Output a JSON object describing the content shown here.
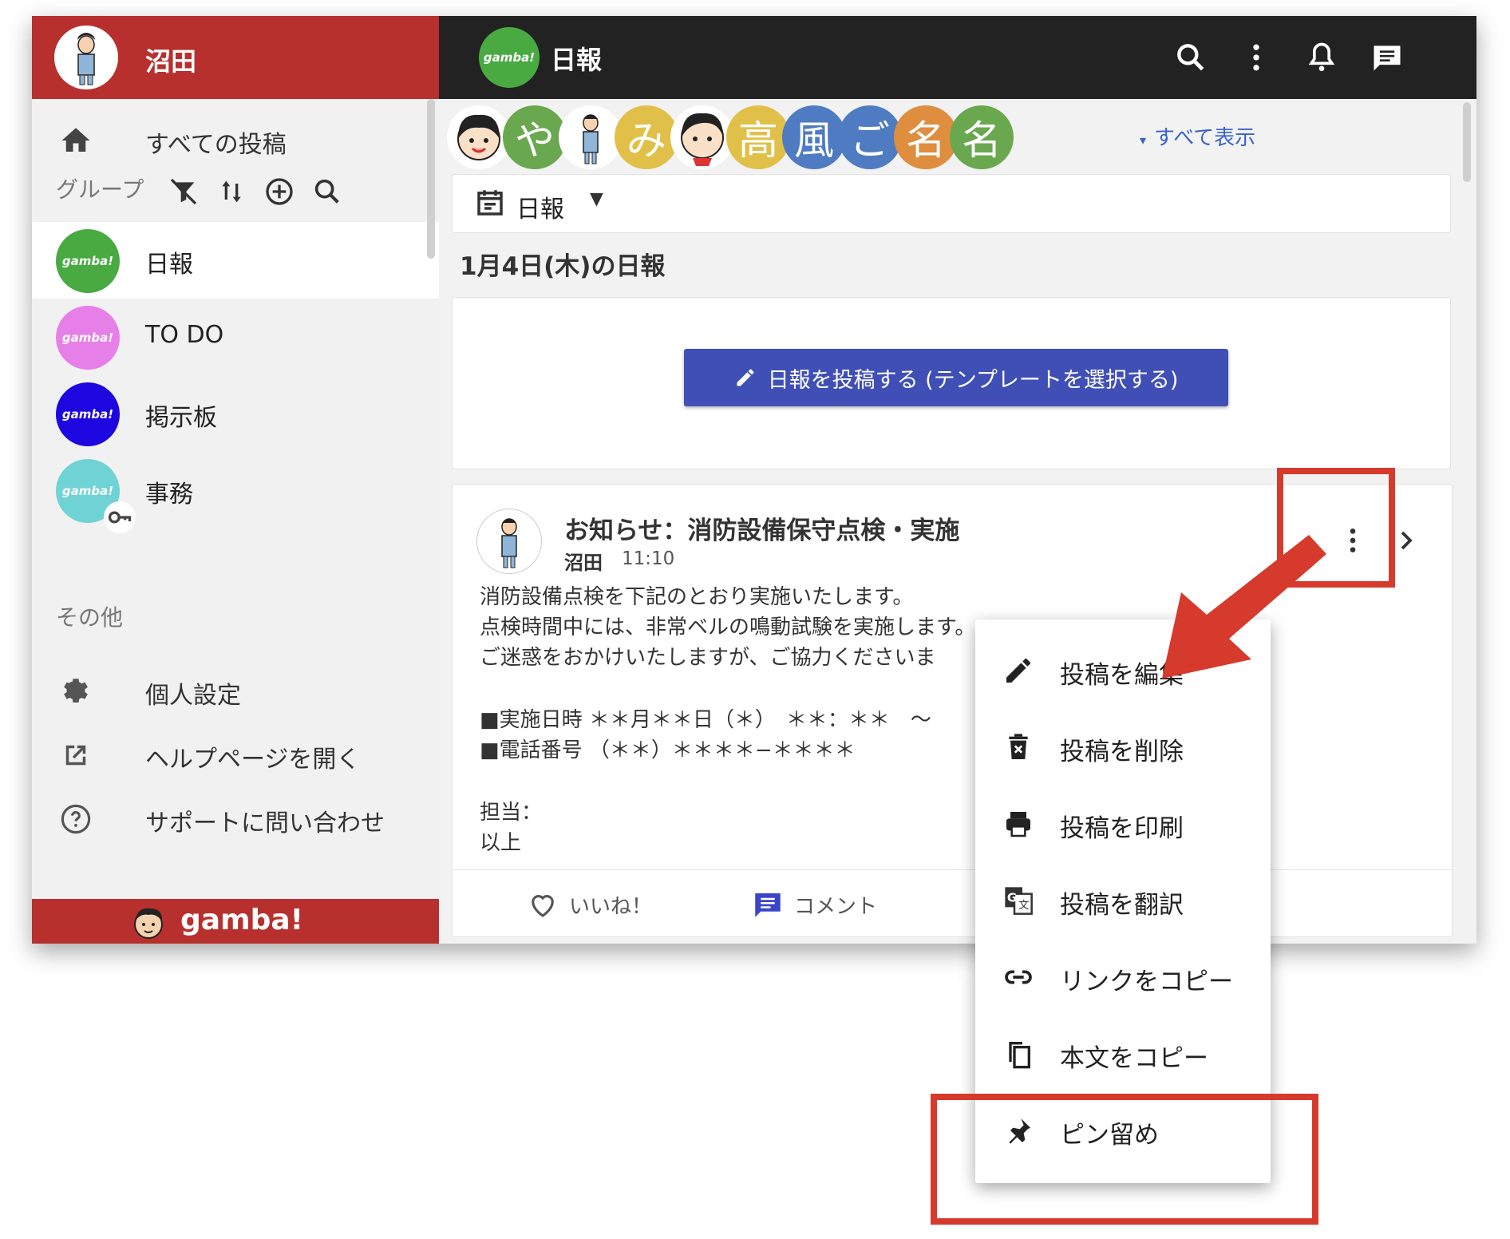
{
  "sidebar": {
    "user_name": "沼田",
    "nav": {
      "all_posts": "すべての投稿"
    },
    "group_section_label": "グループ",
    "groups": [
      {
        "name": "日報",
        "avatar_text": "gamba!",
        "color": "#4aaa42"
      },
      {
        "name": "TO DO",
        "avatar_text": "gamba!",
        "color": "#e77fe9"
      },
      {
        "name": "掲示板",
        "avatar_text": "gamba!",
        "color": "#1d06e0"
      },
      {
        "name": "事務",
        "avatar_text": "gamba!",
        "color": "#6fd3d6"
      }
    ],
    "other_section_label": "その他",
    "other": [
      {
        "label": "個人設定",
        "icon": "gear-icon"
      },
      {
        "label": "ヘルプページを開く",
        "icon": "open-external-icon"
      },
      {
        "label": "サポートに問い合わせ",
        "icon": "help-circle-icon"
      }
    ],
    "footer_brand": "gamba!"
  },
  "header": {
    "logo_text": "gamba!",
    "title": "日報"
  },
  "members": {
    "avatars": [
      {
        "text": "",
        "color": "#ffffff",
        "kind": "face"
      },
      {
        "text": "や",
        "color": "#6aa84f"
      },
      {
        "text": "",
        "color": "#ffffff",
        "kind": "person"
      },
      {
        "text": "み",
        "color": "#e1c04a"
      },
      {
        "text": "",
        "color": "#ffffff",
        "kind": "face"
      },
      {
        "text": "高",
        "color": "#e1c04a"
      },
      {
        "text": "風",
        "color": "#4e7bc1"
      },
      {
        "text": "ご",
        "color": "#4e7bc1"
      },
      {
        "text": "名",
        "color": "#de8e3e"
      },
      {
        "text": "名",
        "color": "#6aa84f"
      }
    ],
    "show_all": "すべて表示"
  },
  "filter": {
    "label": "日報"
  },
  "date_heading": "1月4日(木)の日報",
  "compose": {
    "button_label": "日報を投稿する (テンプレートを選択する)"
  },
  "post": {
    "title": "お知らせ：消防設備保守点検・実施",
    "author": "沼田",
    "time": "11:10",
    "lines": [
      "消防設備点検を下記のとおり実施いたします。",
      "点検時間中には、非常ベルの鳴動試験を実施します。",
      "ご迷惑をおかけいたしますが、ご協力くださいま",
      "",
      "■実施日時 ＊＊月＊＊日（＊）　＊＊：＊＊　～",
      "■電話番号 （＊＊）＊＊＊＊−＊＊＊＊",
      "",
      "担当：",
      "以上"
    ],
    "like_label": "いいね！",
    "comment_label": "コメント"
  },
  "menu": {
    "items": [
      {
        "label": "投稿を編集",
        "icon": "pencil-icon"
      },
      {
        "label": "投稿を削除",
        "icon": "trash-icon"
      },
      {
        "label": "投稿を印刷",
        "icon": "printer-icon"
      },
      {
        "label": "投稿を翻訳",
        "icon": "translate-icon"
      },
      {
        "label": "リンクをコピー",
        "icon": "link-icon"
      },
      {
        "label": "本文をコピー",
        "icon": "copy-icon"
      },
      {
        "label": "ピン留め",
        "icon": "pin-icon"
      }
    ]
  },
  "colors": {
    "brand_red": "#b7302d",
    "accent_blue": "#3f4fb6",
    "highlight_red": "#d63a2c",
    "topbar": "#222222"
  }
}
